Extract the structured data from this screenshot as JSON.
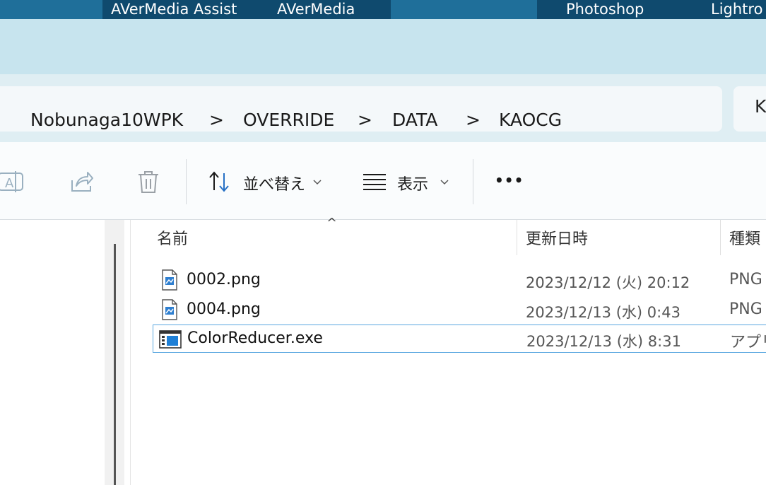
{
  "taskbar": {
    "apps": [
      "AVerMedia Assist",
      "AVerMedia",
      "Photoshop",
      "Lightro"
    ]
  },
  "breadcrumb": {
    "lead_chevron": "›",
    "items": [
      "Nobunaga10WPK",
      "OVERRIDE",
      "DATA",
      "KAOCG"
    ],
    "separator": ">"
  },
  "search": {
    "partial_text": "K"
  },
  "toolbar": {
    "sort_label": "並べ替え",
    "view_label": "表示",
    "more_label": "•••"
  },
  "columns": {
    "name": "名前",
    "date": "更新日時",
    "type": "種類"
  },
  "files": [
    {
      "name": "0002.png",
      "date": "2023/12/12 (火) 20:12",
      "type": "PNG",
      "icon": "png-image-icon"
    },
    {
      "name": "0004.png",
      "date": "2023/12/13 (水) 0:43",
      "type": "PNG",
      "icon": "png-image-icon"
    },
    {
      "name": "ColorReducer.exe",
      "date": "2023/12/13 (水) 8:31",
      "type": "アプリ",
      "icon": "exe-app-icon"
    }
  ],
  "colors": {
    "taskbar_bg": "#1f6f9a",
    "titlebar_bg": "#c7e4ee",
    "selection_border": "#5aa7e0"
  }
}
